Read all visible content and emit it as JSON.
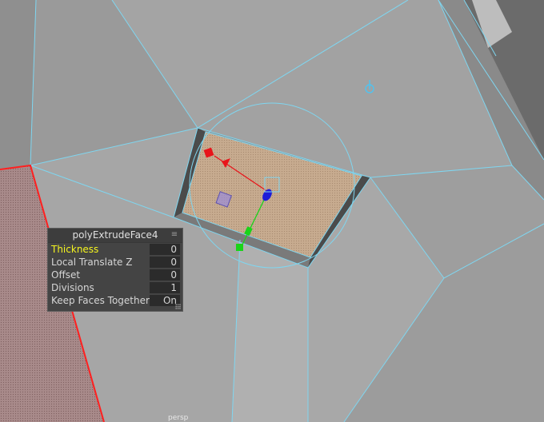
{
  "colors": {
    "wireframe": "#7fd6f0",
    "selected_face": "#c3a98d",
    "red_edge": "#ff2020",
    "highlight_label": "#f5f51e",
    "panel_bg": "#444444",
    "x_axis": "#e8141a",
    "y_axis": "#19d419",
    "z_axis": "#1c1cd8"
  },
  "hud": {
    "title": "polyExtrudeFace4",
    "menu_icon": "≡",
    "rows": [
      {
        "label": "Thickness",
        "value": "0",
        "active": true
      },
      {
        "label": "Local Translate Z",
        "value": "0",
        "active": false
      },
      {
        "label": "Offset",
        "value": "0",
        "active": false
      },
      {
        "label": "Divisions",
        "value": "1",
        "active": false
      },
      {
        "label": "Keep Faces Together",
        "value": "On",
        "active": false
      }
    ]
  },
  "viewport": {
    "camera_label": "persp",
    "pivot_icon": "pivot-icon",
    "manipulator": "move-rotate-scale-manipulator"
  }
}
